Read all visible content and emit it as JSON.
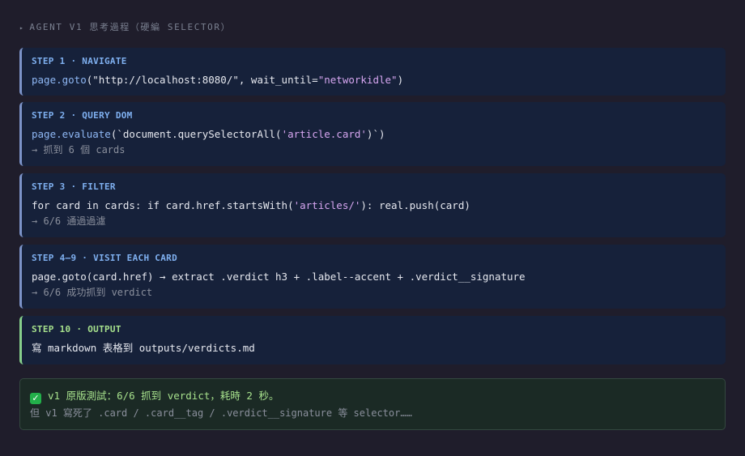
{
  "header": {
    "title": "AGENT V1 思考過程（硬編 SELECTOR）"
  },
  "steps": [
    {
      "title": "STEP 1 · NAVIGATE",
      "code_fn": "page.goto",
      "code_a": "(\"http://localhost:8080/\", wait_until=",
      "code_str": "\"networkidle\"",
      "code_b": ")"
    },
    {
      "title": "STEP 2 · QUERY DOM",
      "code_fn": "page.evaluate",
      "code_a": "(`document.querySelectorAll(",
      "code_str": "'article.card'",
      "code_b": ")`)",
      "note": "→ 抓到 6 個 cards"
    },
    {
      "title": "STEP 3 · FILTER",
      "code_a": "for card in cards: if card.href.startsWith(",
      "code_str": "'articles/'",
      "code_b": "): real.push(card)",
      "note": "→ 6/6 通過過濾"
    },
    {
      "title": "STEP 4–9 · VISIT EACH CARD",
      "code_a": "page.goto(card.href) → extract .verdict h3 + .label--accent + .verdict__signature",
      "note": "→ 6/6 成功抓到 verdict"
    },
    {
      "title": "STEP 10 · OUTPUT",
      "code_a": "寫 markdown 表格到 outputs/verdicts.md"
    }
  ],
  "result": {
    "icon": "check-mark-icon",
    "icon_glyph": "✓",
    "main": "v1 原版測試：6/6 抓到 verdict，耗時 2 秒。",
    "sub": "但 v1 寫死了 .card / .card__tag / .verdict__signature 等 selector……"
  }
}
